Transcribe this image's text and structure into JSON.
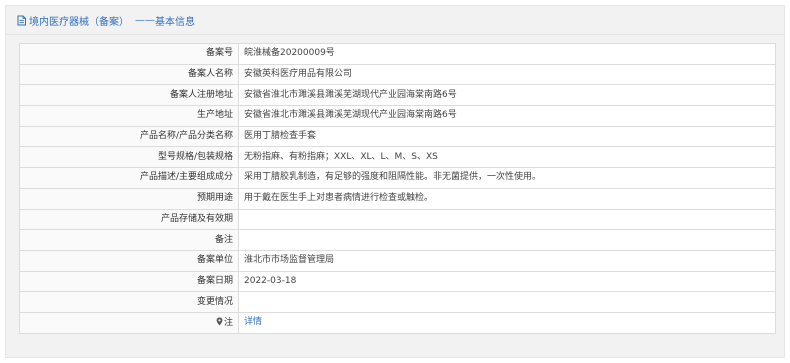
{
  "header": {
    "title": "境内医疗器械（备案）",
    "separator": "——",
    "subtitle": "基本信息",
    "icon": "document-icon"
  },
  "rows": [
    {
      "label": "备案号",
      "value": "皖淮械备20200009号"
    },
    {
      "label": "备案人名称",
      "value": "安徽英科医疗用品有限公司"
    },
    {
      "label": "备案人注册地址",
      "value": "安徽省淮北市濉溪县濉溪芜湖现代产业园海棠南路6号"
    },
    {
      "label": "生产地址",
      "value": "安徽省淮北市濉溪县濉溪芜湖现代产业园海棠南路6号"
    },
    {
      "label": "产品名称/产品分类名称",
      "value": "医用丁腈检查手套"
    },
    {
      "label": "型号规格/包装规格",
      "value": "无粉指麻、有粉指麻；XXL、XL、L、M、S、XS"
    },
    {
      "label": "产品描述/主要组成成分",
      "value": "采用丁腈胶乳制造，有足够的强度和阻隔性能。非无菌提供，一次性使用。"
    },
    {
      "label": "预期用途",
      "value": "用于戴在医生手上对患者病情进行检查或触检。"
    },
    {
      "label": "产品存储及有效期",
      "value": ""
    },
    {
      "label": "备注",
      "value": ""
    },
    {
      "label": "备案单位",
      "value": "淮北市市场监督管理局"
    },
    {
      "label": "备案日期",
      "value": "2022-03-18"
    },
    {
      "label": "变更情况",
      "value": ""
    },
    {
      "label": "注",
      "value": "详情",
      "icon": "location-pin-icon"
    }
  ],
  "colors": {
    "link": "#2f6fbe",
    "border": "#dcdcdc",
    "panel_bg": "#f2f2f2"
  }
}
